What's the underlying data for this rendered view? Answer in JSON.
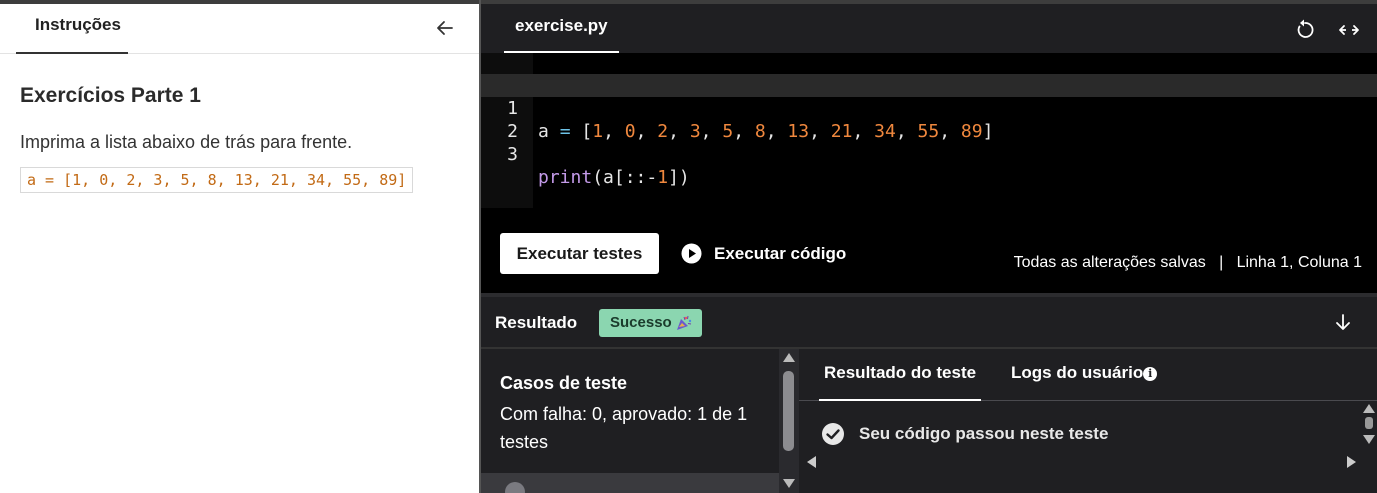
{
  "instructions": {
    "tab_label": "Instruções",
    "exercise_title": "Exercícios Parte 1",
    "description": "Imprima a lista abaixo de trás para frente.",
    "code_snippet": "a = [1, 0, 2, 3, 5, 8, 13, 21, 34, 55, 89]"
  },
  "editor": {
    "file_tab": "exercise.py",
    "lines": [
      {
        "number": "1",
        "code": "a = [1, 0, 2, 3, 5, 8, 13, 21, 34, 55, 89]"
      },
      {
        "number": "2",
        "code": ""
      },
      {
        "number": "3",
        "code": "print(a[::-1])"
      }
    ],
    "run_tests_label": "Executar testes",
    "run_code_label": "Executar código",
    "save_status": "Todas as alterações salvas",
    "separator": "|",
    "cursor_position": "Linha 1, Coluna 1"
  },
  "result": {
    "label": "Resultado",
    "badge": "Sucesso",
    "badge_color": "#8bd6b0",
    "cases_title": "Casos de teste",
    "cases_summary": "Com falha: 0, aprovado: 1 de 1 testes",
    "tab_test_result": "Resultado do teste",
    "tab_user_logs": "Logs do usuário",
    "pass_message": "Seu código passou neste teste"
  },
  "icons": {
    "back": "arrow-left-icon",
    "reset": "reset-icon",
    "expand": "expand-horizontal-icon",
    "play": "play-icon",
    "collapse": "arrow-down-icon",
    "check": "check-circle-icon",
    "info": "info-icon"
  }
}
